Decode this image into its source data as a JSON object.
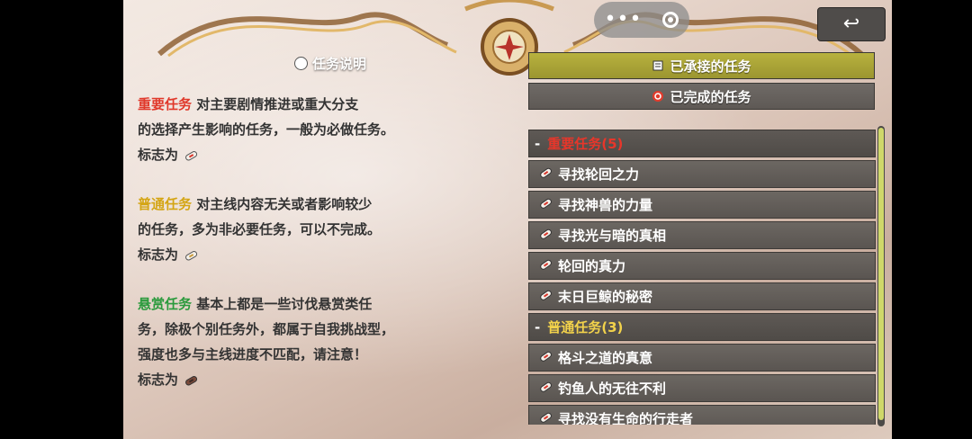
{
  "help": {
    "title": "任务说明",
    "sections": [
      {
        "keyword": "重要任务",
        "lines": [
          " 对主要剧情推进或重大分支",
          "的选择产生影响的任务，一般为必做任务。",
          "标志为"
        ]
      },
      {
        "keyword": "普通任务",
        "lines": [
          " 对主线内容无关或者影响较少",
          "的任务，多为非必要任务，可以不完成。",
          "标志为"
        ]
      },
      {
        "keyword": "悬赏任务",
        "lines": [
          " 基本上都是一些讨伐悬赏类任",
          "务，除极个别任务外，都属于自我挑战型，",
          "强度也多与主线进度不匹配，请注意！",
          "标志为"
        ]
      }
    ]
  },
  "tabs": {
    "accepted": "已承接的任务",
    "completed": "已完成的任务"
  },
  "quest_list": {
    "groups": [
      {
        "header": "重要任务(5)",
        "color": "#e8362a",
        "items": [
          "寻找轮回之力",
          "寻找神兽的力量",
          "寻找光与暗的真相",
          "轮回的真力",
          "末日巨鲸的秘密"
        ]
      },
      {
        "header": "普通任务(3)",
        "color": "#f2d24b",
        "items": [
          "格斗之道的真意",
          "钓鱼人的无往不利",
          "寻找没有生命的行走者"
        ]
      }
    ]
  },
  "back_icon": "return-arrow-icon"
}
